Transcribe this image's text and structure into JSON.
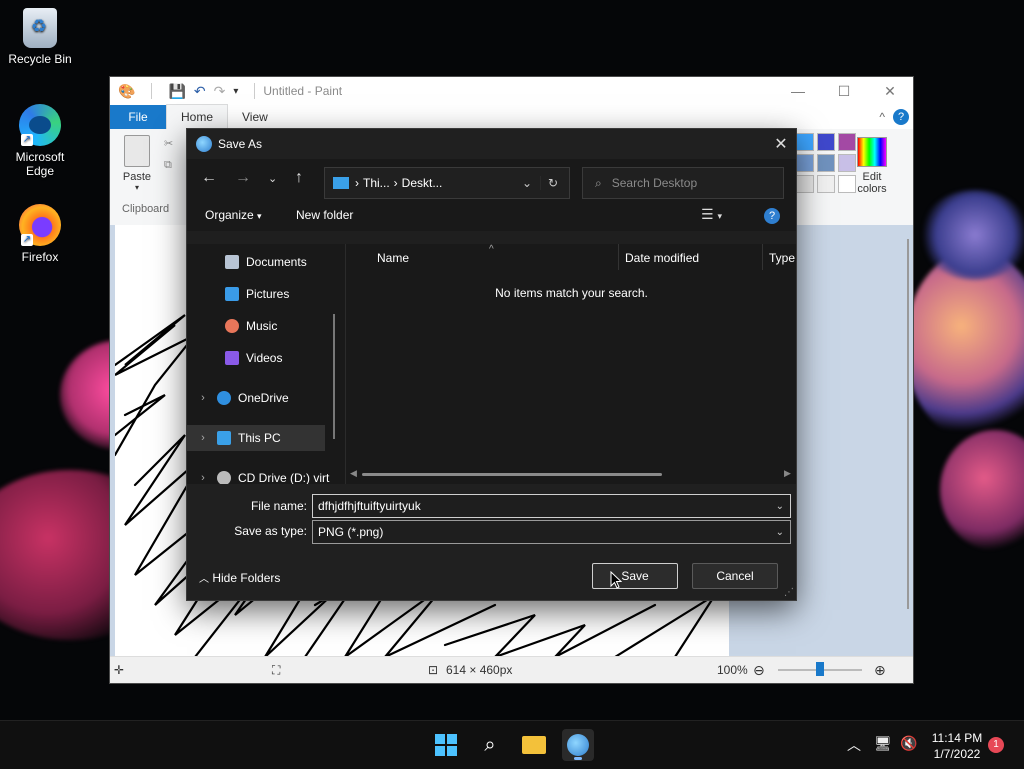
{
  "desktop": {
    "icons": [
      {
        "label": "Recycle Bin"
      },
      {
        "label": "Microsoft Edge"
      },
      {
        "label": "Firefox"
      }
    ]
  },
  "paint": {
    "title": "Untitled - Paint",
    "tabs": {
      "file": "File",
      "home": "Home",
      "view": "View"
    },
    "ribbon": {
      "paste_label": "Paste",
      "clipboard_label": "Clipboard",
      "edit_colors_label": "Edit colors"
    },
    "status": {
      "dimensions": "614 × 460px",
      "zoom": "100%"
    },
    "colors": [
      "#3da5ff",
      "#3f48cc",
      "#a349a4",
      "#78a0d8",
      "#7092be",
      "#c8bfe7",
      "#e6e6e6",
      "#f0f0f0",
      "#ffffff"
    ]
  },
  "dialog": {
    "title": "Save As",
    "address": {
      "crumbs": [
        "Thi...",
        "Deskt..."
      ]
    },
    "search_placeholder": "Search Desktop",
    "toolbar": {
      "organize": "Organize",
      "new_folder": "New folder"
    },
    "nav_items": [
      {
        "label": "Documents",
        "icon": "documents-icon",
        "pinned": true
      },
      {
        "label": "Pictures",
        "icon": "pictures-icon",
        "pinned": true
      },
      {
        "label": "Music",
        "icon": "music-icon",
        "pinned": false
      },
      {
        "label": "Videos",
        "icon": "videos-icon",
        "pinned": false
      },
      {
        "label": "OneDrive",
        "icon": "onedrive-icon",
        "pinned": false
      },
      {
        "label": "This PC",
        "icon": "this-pc-icon",
        "pinned": false
      },
      {
        "label": "CD Drive (D:) virt",
        "icon": "cd-drive-icon",
        "pinned": false
      }
    ],
    "columns": [
      "Name",
      "Date modified",
      "Type"
    ],
    "empty_message": "No items match your search.",
    "file_name_label": "File name:",
    "file_name_value": "dfhjdfhjftuiftyuirtyuk",
    "save_type_label": "Save as type:",
    "save_type_value": "PNG (*.png)",
    "hide_folders": "Hide Folders",
    "save_button": "Save",
    "cancel_button": "Cancel"
  },
  "taskbar": {
    "time": "11:14 PM",
    "date": "1/7/2022",
    "notifications": "1"
  }
}
